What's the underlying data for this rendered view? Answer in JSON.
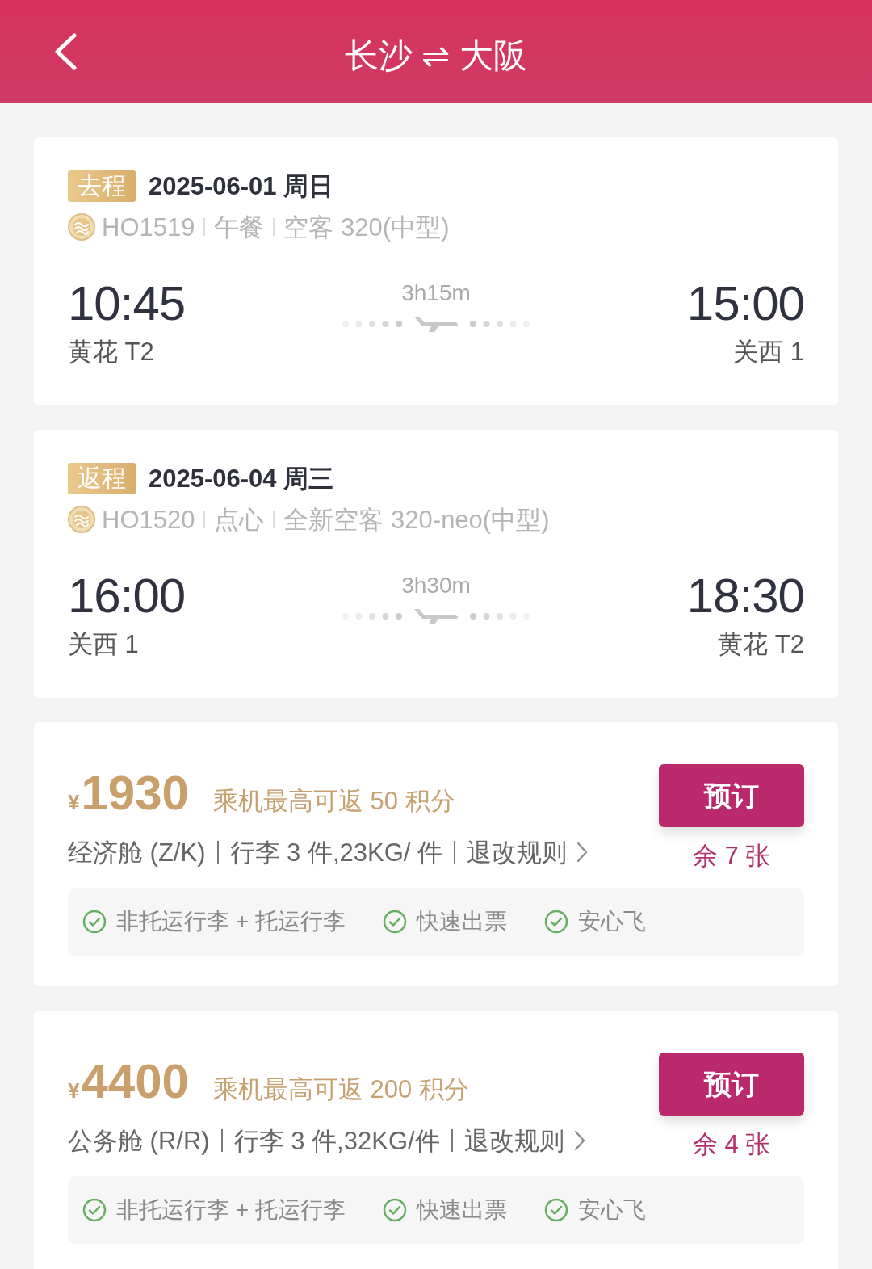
{
  "header": {
    "title": "长沙 ⇌ 大阪"
  },
  "flights": [
    {
      "leg": "去程",
      "date": "2025-06-01 周日",
      "flight_number": "HO1519",
      "meal": "午餐",
      "aircraft": "空客 320(中型)",
      "depart_time": "10:45",
      "depart_airport": "黄花 T2",
      "duration": "3h15m",
      "arrive_time": "15:00",
      "arrive_airport": "关西 1"
    },
    {
      "leg": "返程",
      "date": "2025-06-04 周三",
      "flight_number": "HO1520",
      "meal": "点心",
      "aircraft": "全新空客 320-neo(中型)",
      "depart_time": "16:00",
      "depart_airport": "关西 1",
      "duration": "3h30m",
      "arrive_time": "18:30",
      "arrive_airport": "黄花 T2"
    }
  ],
  "fares": [
    {
      "currency": "¥",
      "price": "1930",
      "points": "乘机最高可返 50 积分",
      "cabin": "经济舱 (Z/K)",
      "baggage": "行李 3 件,23KG/ 件",
      "rules_link": "退改规则",
      "button": "预订",
      "remaining": "余 7 张",
      "features": [
        "非托运行李 + 托运行李",
        "快速出票",
        "安心飞"
      ]
    },
    {
      "currency": "¥",
      "price": "4400",
      "points": "乘机最高可返 200 积分",
      "cabin": "公务舱 (R/R)",
      "baggage": "行李 3 件,32KG/件",
      "rules_link": "退改规则",
      "button": "预订",
      "remaining": "余 4 张",
      "features": [
        "非托运行李 + 托运行李",
        "快速出票",
        "安心飞"
      ]
    }
  ]
}
